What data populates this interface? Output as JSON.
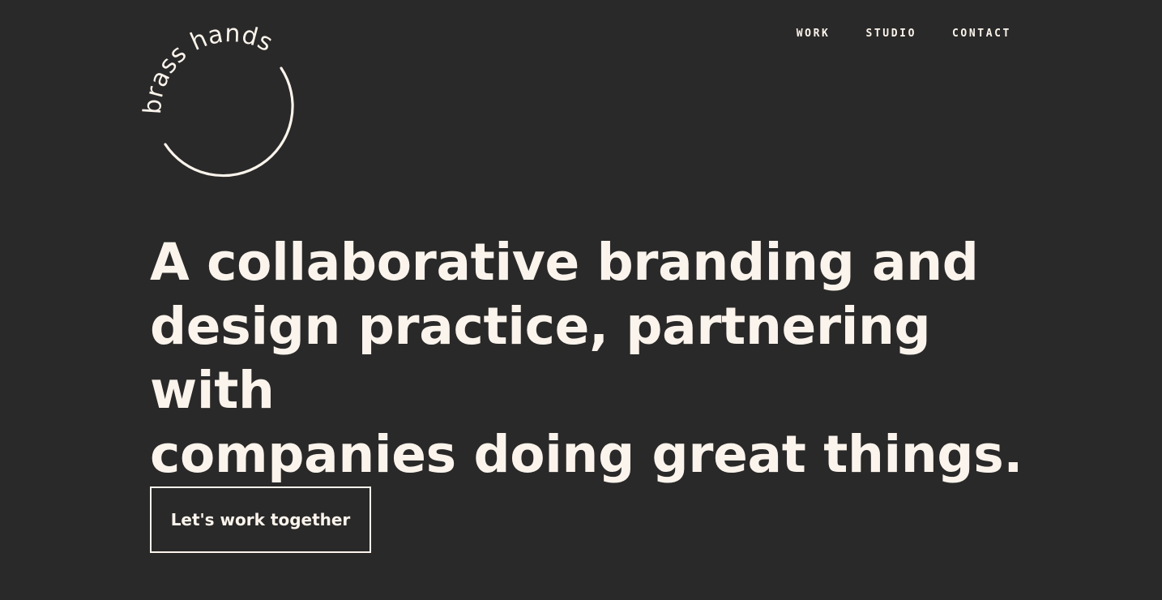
{
  "logo": {
    "text": "brass hands"
  },
  "nav": {
    "items": [
      {
        "label": "WORK"
      },
      {
        "label": "STUDIO"
      },
      {
        "label": "CONTACT"
      }
    ]
  },
  "hero": {
    "title": "A collaborative branding and\ndesign practice, partnering with\ncompanies doing great things.",
    "cta_label": "Let's work together"
  },
  "colors": {
    "background": "#2a2929",
    "foreground": "#fbf4ec"
  }
}
